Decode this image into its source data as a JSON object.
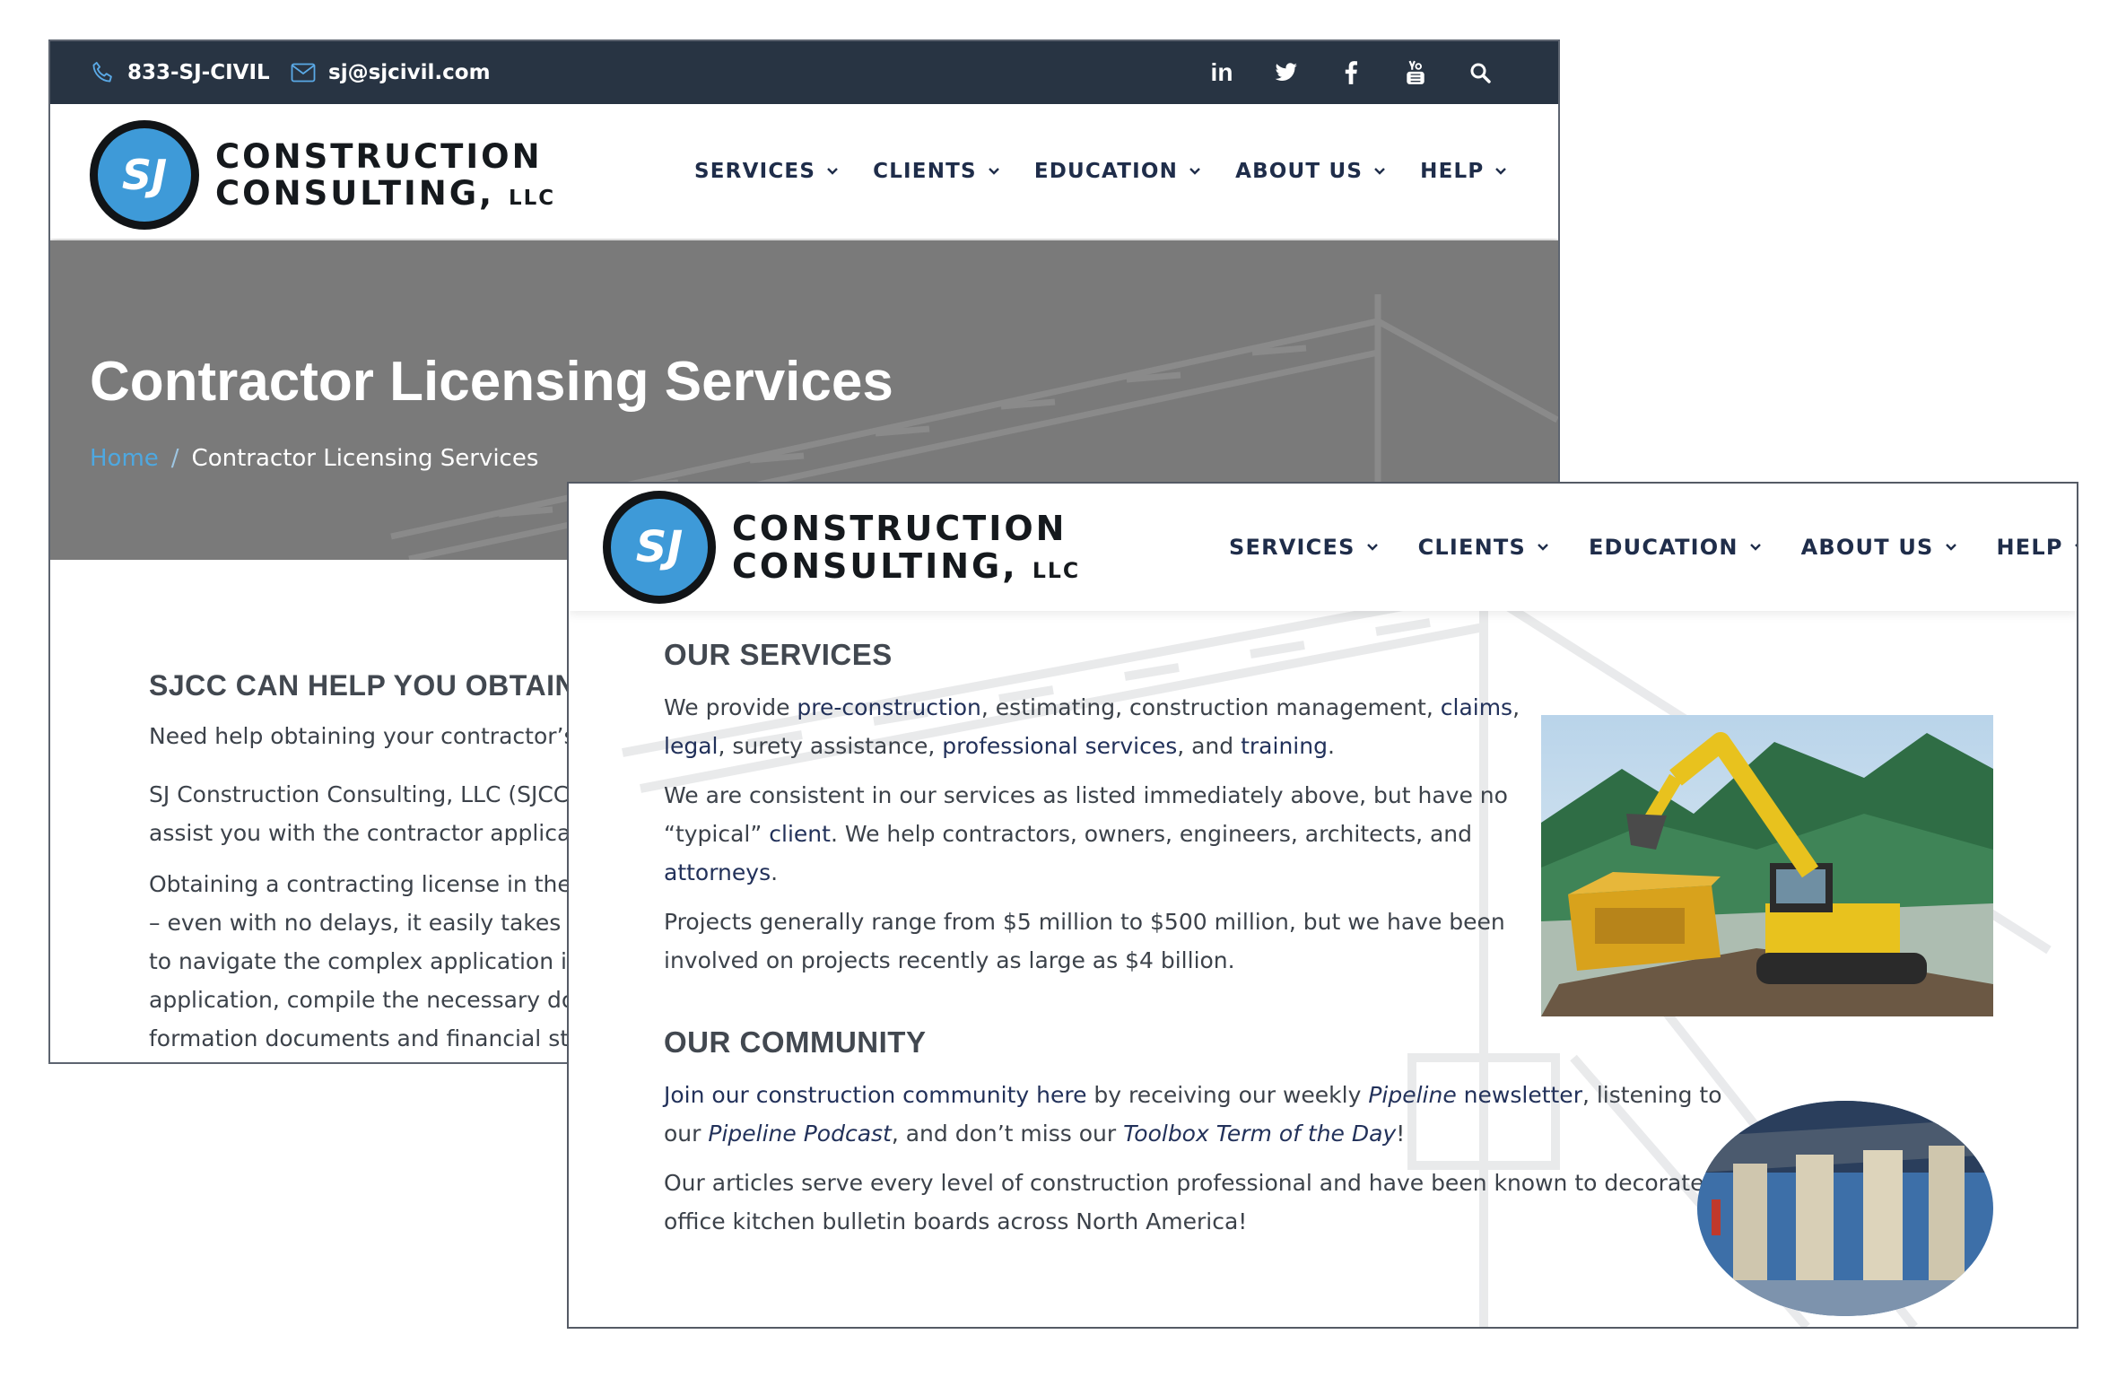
{
  "top_bar": {
    "phone": "833-SJ-CIVIL",
    "email": "sj@sjcivil.com",
    "social": [
      "linkedin-icon",
      "twitter-icon",
      "facebook-icon",
      "youtube-icon",
      "search-icon"
    ],
    "linkedin_text": "in"
  },
  "brand": {
    "monogram": "SJ",
    "line1": "CONSTRUCTION",
    "line2": "CONSULTING,",
    "llc": "LLC"
  },
  "nav": {
    "items": [
      "SERVICES",
      "CLIENTS",
      "EDUCATION",
      "ABOUT US",
      "HELP"
    ]
  },
  "back_page": {
    "hero_title": "Contractor Licensing Services",
    "breadcrumb": {
      "home": "Home",
      "separator": "/",
      "current": "Contractor Licensing Services"
    },
    "heading": "SJCC CAN HELP YOU OBTAIN",
    "p1": "Need help obtaining your contractor’s lic",
    "p2_lines": [
      "SJ Construction Consulting, LLC (SJCC) ha",
      "assist you with the contractor applicatior"
    ],
    "p3_lines": [
      "Obtaining a contracting license in the sta",
      "– even with no delays, it easily takes mo",
      "to navigate the complex application instr",
      "application, compile the necessary docur",
      "formation documents and financial state"
    ]
  },
  "front_page": {
    "services_heading": "OUR SERVICES",
    "services_p1": {
      "t1": "We provide ",
      "l1": "pre-construction",
      "t2": ", estimating, construction management, ",
      "l2": "claims",
      "t3": ",",
      "l3": "legal",
      "t4": ", surety assistance, ",
      "l4": "professional services",
      "t5": ", and ",
      "l5": "training",
      "t6": "."
    },
    "services_p2": {
      "t1": "We are consistent in our services as listed immediately above, but have no",
      "t2": "“typical” ",
      "l1": "client",
      "t3": ".  We help contractors, owners, engineers, architects, and",
      "l2": "attorneys",
      "t4": "."
    },
    "services_p3_lines": [
      "Projects generally range from $5 million to $500 million, but we have been",
      "involved on projects recently as large as $4 billion."
    ],
    "community_heading": "OUR COMMUNITY",
    "community_p1": {
      "l1": "Join our construction community here",
      "t1": " by receiving our weekly ",
      "l2": "Pipeline",
      "l3": " newsletter",
      "t2": ", listening to",
      "t3": "our ",
      "l4": "Pipeline Podcast",
      "t4": ", and don’t miss our ",
      "l5": "Toolbox Term of the Day",
      "t5": "!"
    },
    "community_p2_lines": [
      "Our articles serve every level of construction professional and have been known to decorate",
      "office kitchen bulletin boards across North America!"
    ]
  },
  "colors": {
    "topbar": "#283443",
    "nav_text": "#1f2d4a",
    "link": "#22315a",
    "accent_blue": "#3e9ad8",
    "hero_gray": "#7a7a7a"
  }
}
